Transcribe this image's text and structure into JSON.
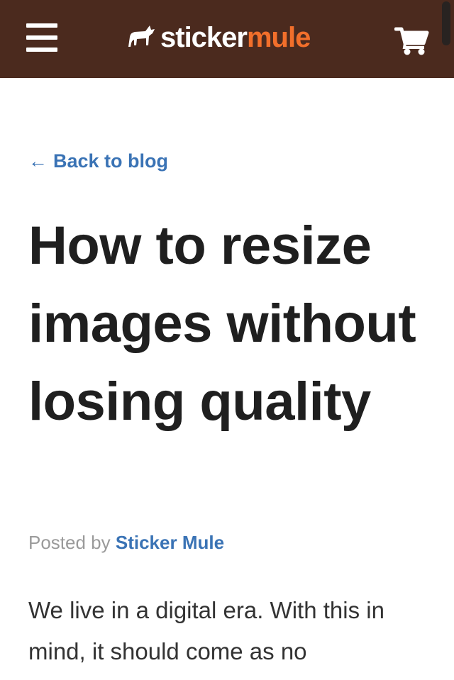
{
  "header": {
    "menu_icon": "hamburger-menu-icon",
    "logo": {
      "icon": "mule-icon",
      "word_primary": "sticker",
      "word_accent": "mule",
      "accent_color": "#f26f2b"
    },
    "cart_icon": "shopping-cart-icon",
    "background_color": "#4b2a1e"
  },
  "article": {
    "back_link": {
      "arrow": "←",
      "label": "Back to blog"
    },
    "title": "How to resize images without losing quality",
    "byline": {
      "prefix": "Posted by",
      "author": "Sticker Mule"
    },
    "body_preview": "We live in a digital era. With this in mind, it should come as no"
  },
  "colors": {
    "link": "#3a73b5",
    "title": "#1f1f1f",
    "byline": "#9a9a9a"
  }
}
